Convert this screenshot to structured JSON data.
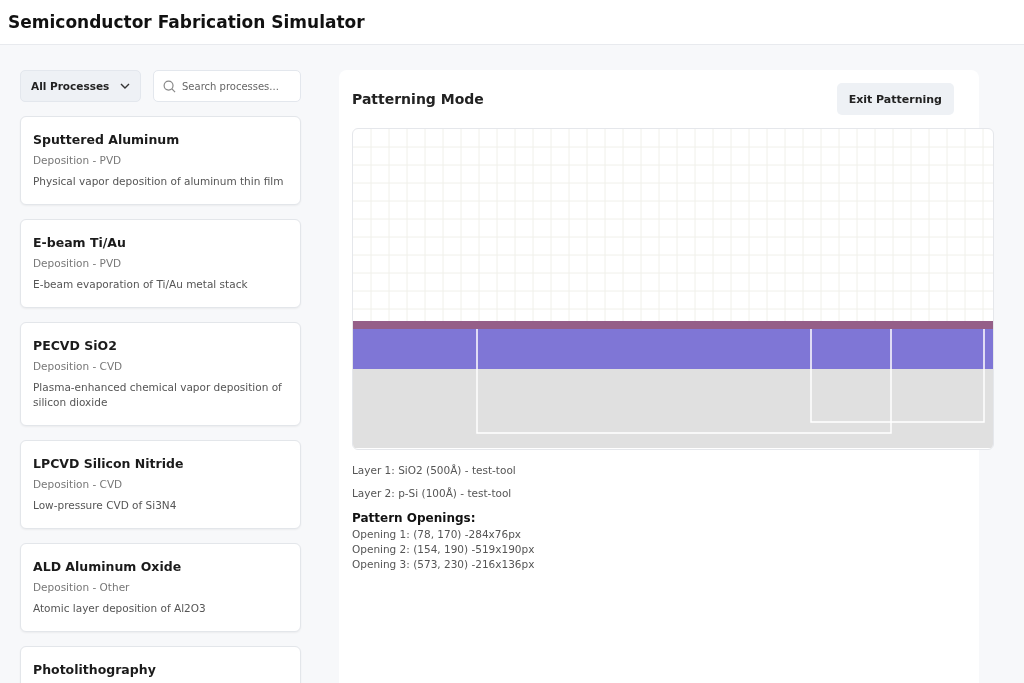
{
  "app_title": "Semiconductor Fabrication Simulator",
  "filter": {
    "label": "All Processes"
  },
  "search": {
    "placeholder": "Search processes..."
  },
  "processes": [
    {
      "name": "Sputtered Aluminum",
      "category": "Deposition - PVD",
      "description": "Physical vapor deposition of aluminum thin film"
    },
    {
      "name": "E-beam Ti/Au",
      "category": "Deposition - PVD",
      "description": "E-beam evaporation of Ti/Au metal stack"
    },
    {
      "name": "PECVD SiO2",
      "category": "Deposition - CVD",
      "description": "Plasma-enhanced chemical vapor deposition of silicon dioxide"
    },
    {
      "name": "LPCVD Silicon Nitride",
      "category": "Deposition - CVD",
      "description": "Low-pressure CVD of Si3N4"
    },
    {
      "name": "ALD Aluminum Oxide",
      "category": "Deposition - Other",
      "description": "Atomic layer deposition of Al2O3"
    },
    {
      "name": "Photolithography"
    }
  ],
  "panel": {
    "title": "Patterning Mode",
    "exit_button": "Exit Patterning"
  },
  "layers": [
    "Layer 1: SiO2 (500Å) - test-tool",
    "Layer 2: p-Si (100Å) - test-tool"
  ],
  "openings": {
    "title": "Pattern Openings:",
    "items": [
      "Opening 1: (78, 170) -284x76px",
      "Opening 2: (154, 190) -519x190px",
      "Opening 3: (573, 230) -216x136px"
    ]
  }
}
